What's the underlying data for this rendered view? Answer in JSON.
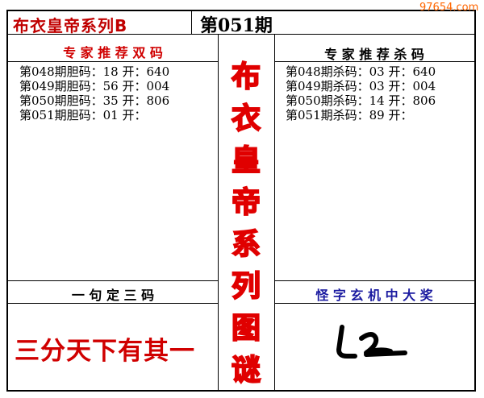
{
  "watermark": "97654.com",
  "header": {
    "title": "布衣皇帝系列B",
    "issue": "第051期"
  },
  "left_panel": {
    "title": "专 家 推 荐 双 码",
    "rows": [
      "第048期胆码：18 开：640",
      "第049期胆码：56 开：004",
      "第050期胆码：35 开：806",
      "第051期胆码：01 开："
    ]
  },
  "right_panel": {
    "title": "专 家 推 荐 杀 码",
    "rows": [
      "第048期杀码：03 开：640",
      "第049期杀码：03 开：004",
      "第050期杀码：14 开：806",
      "第051期杀码：89 开："
    ]
  },
  "vertical_title": [
    "布",
    "衣",
    "皇",
    "帝",
    "系",
    "列",
    "图",
    "谜"
  ],
  "bottom_left": {
    "title": "一 句 定 三 码",
    "phrase": "三分天下有其一"
  },
  "bottom_right": {
    "title": "怪 字 玄 机 中 大 奖"
  },
  "colors": {
    "red": "#d00000",
    "blue": "#1a1aa0",
    "title_red": "#c00000",
    "watermark_orange": "#ff6600"
  },
  "icons": {
    "riddle_glyph": "handwritten-glyph-icon"
  }
}
